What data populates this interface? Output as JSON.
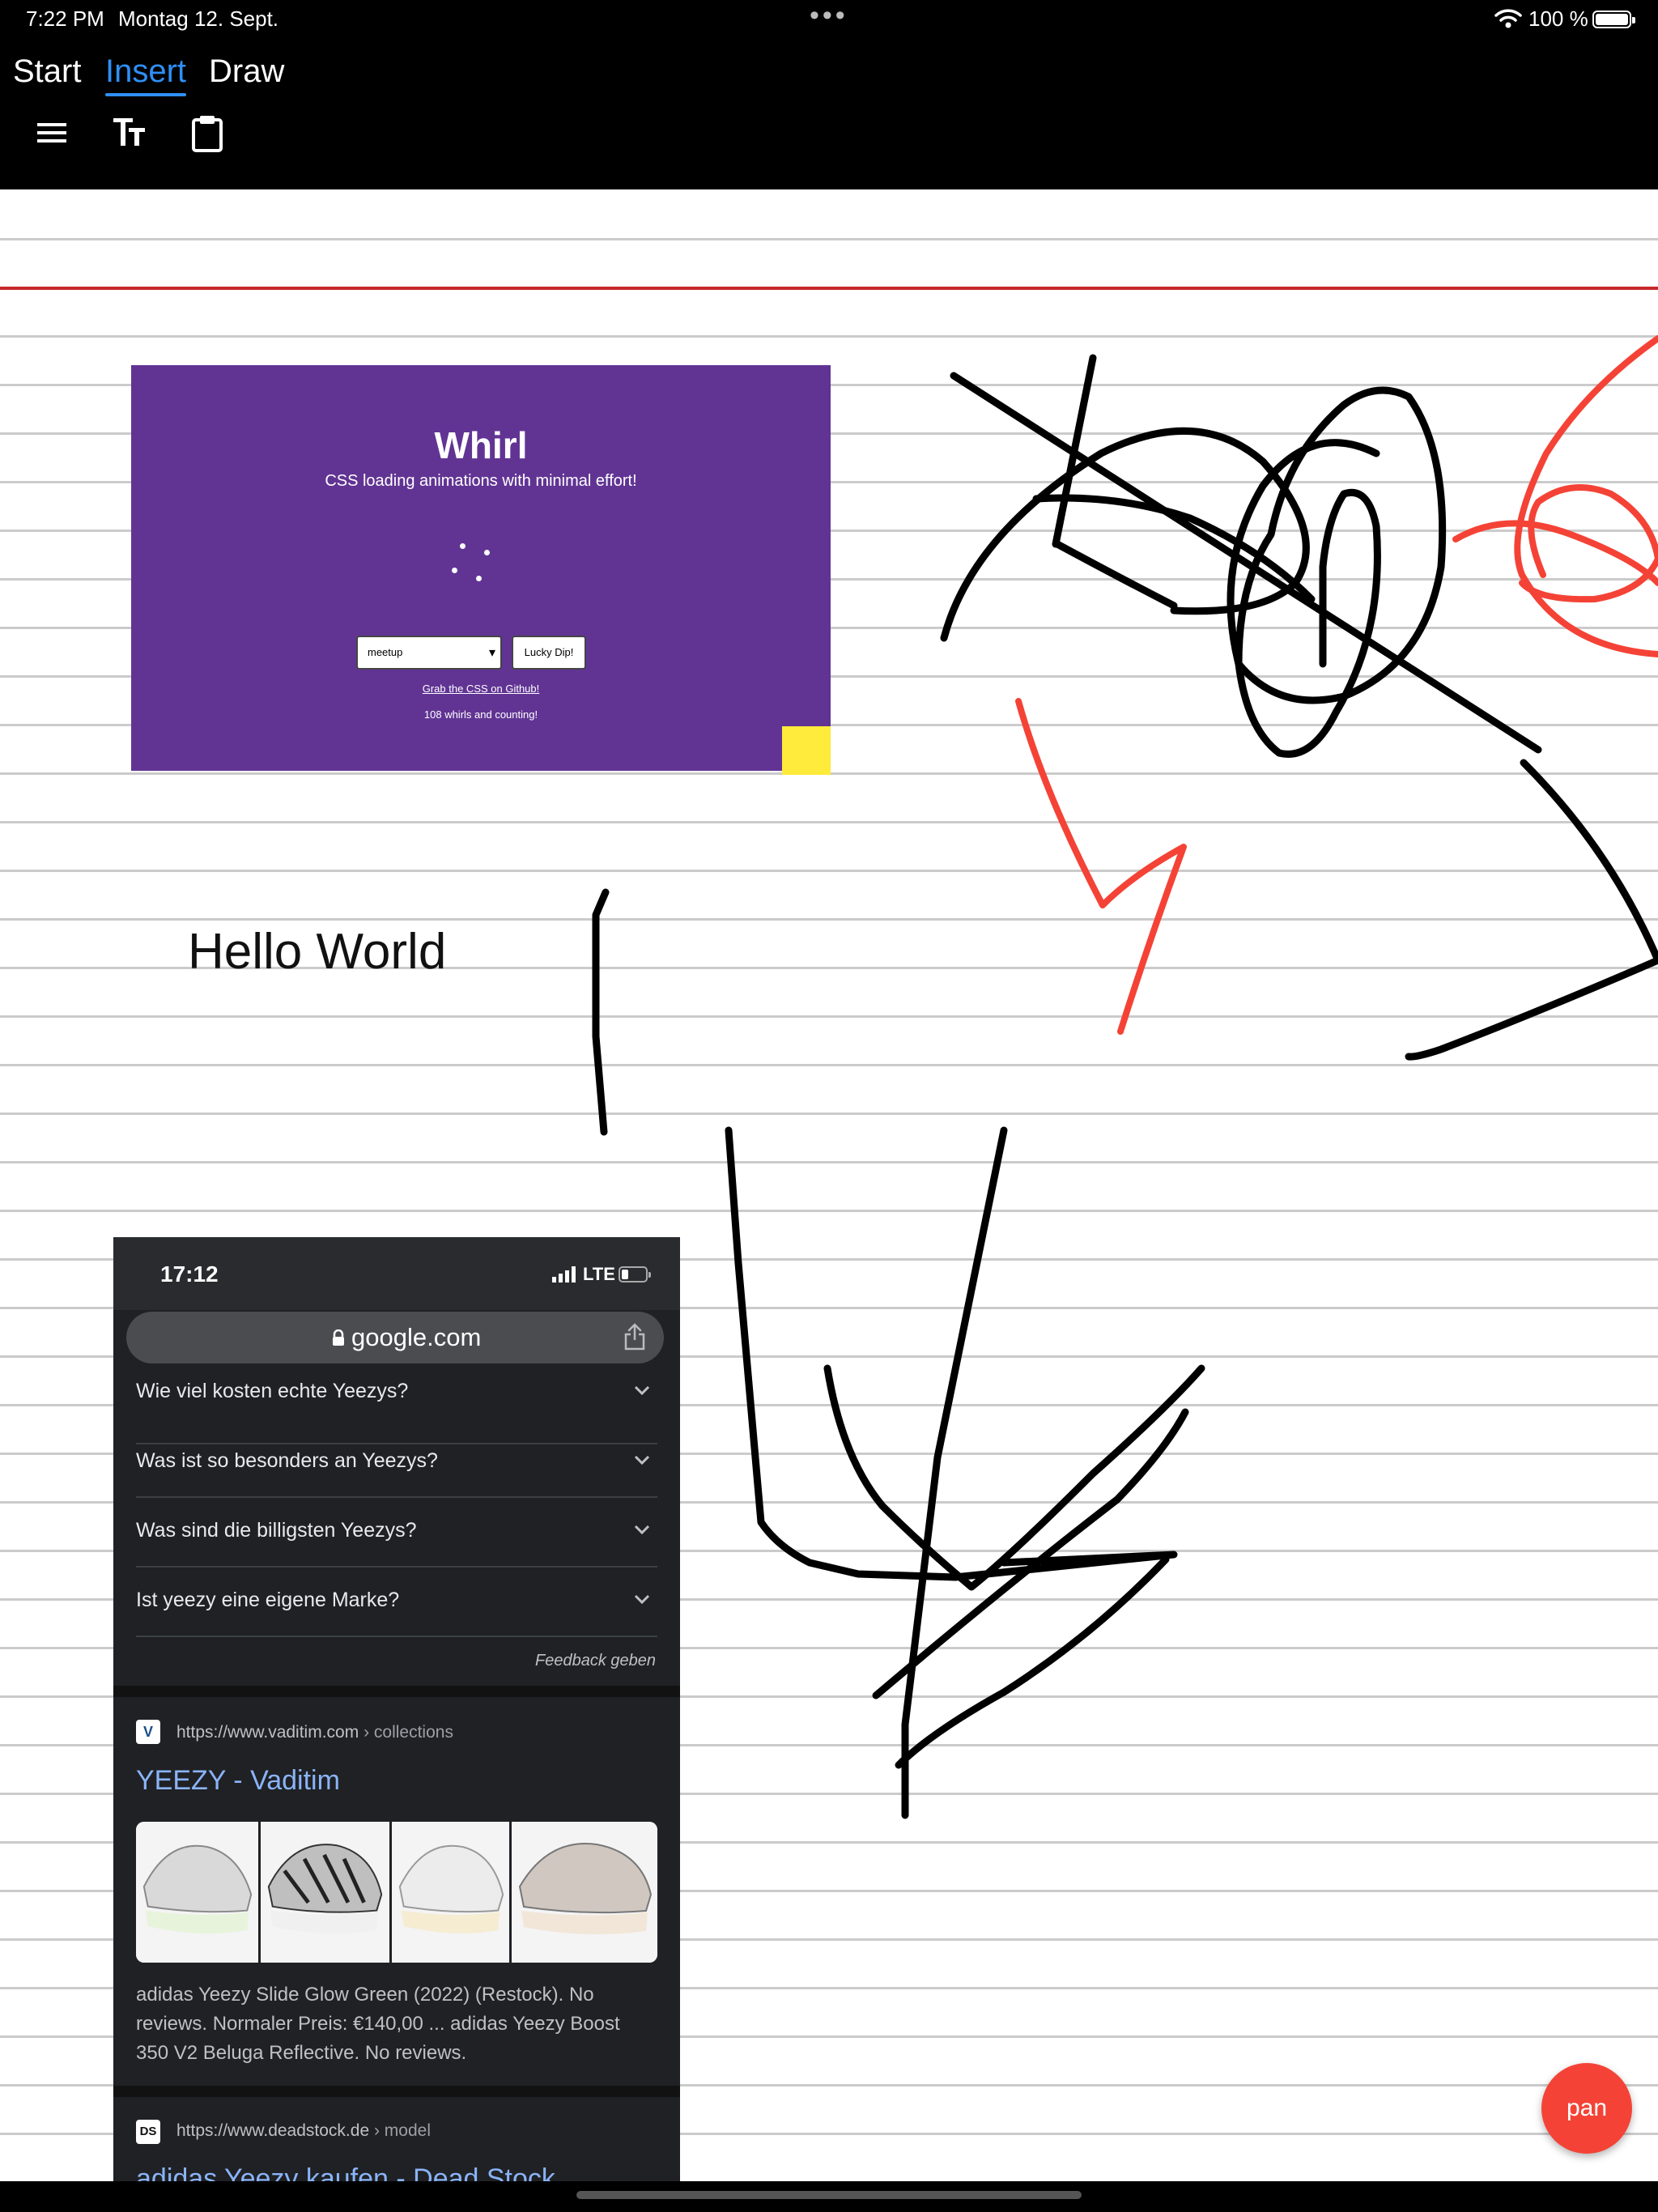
{
  "status_bar": {
    "time": "7:22 PM",
    "date": "Montag 12. Sept.",
    "battery": "100 %"
  },
  "tabs": [
    {
      "label": "Start",
      "active": false
    },
    {
      "label": "Insert",
      "active": true
    },
    {
      "label": "Draw",
      "active": false
    }
  ],
  "toolbar": {
    "icons": [
      "menu-icon",
      "text-size-icon",
      "clipboard-icon"
    ]
  },
  "colors": {
    "accent": "#2f8ff5",
    "margin_line": "#c8282a",
    "ink_black": "#000000",
    "ink_red": "#f44336",
    "whirl_bg": "#613494"
  },
  "whirl_card": {
    "title": "Whirl",
    "subtitle": "CSS loading animations with minimal effort!",
    "select_value": "meetup",
    "button": "Lucky Dip!",
    "link": "Grab the CSS on Github!",
    "count": "108 whirls and counting!"
  },
  "text_box": "Hello World",
  "phone": {
    "time": "17:12",
    "network": "LTE",
    "url": "google.com",
    "faqs": [
      "Wie viel kosten echte Yeezys?",
      "Was ist so besonders an Yeezys?",
      "Was sind die billigsten Yeezys?",
      "Ist yeezy eine eigene Marke?"
    ],
    "feedback": "Feedback geben",
    "result1": {
      "icon": "V",
      "url": "https://www.vaditim.com",
      "crumb": " › collections",
      "title": "YEEZY - Vaditim",
      "snippet": "adidas Yeezy Slide Glow Green (2022) (Restock). No reviews. Normaler Preis: €140,00 ... adidas Yeezy Boost 350 V2 Beluga Reflective. No reviews."
    },
    "result2": {
      "icon": "DS",
      "url": "https://www.deadstock.de",
      "crumb": " › model",
      "title": "adidas Yeezy kaufen - Dead Stock Sneakerbox"
    }
  },
  "pan_button": "pan"
}
